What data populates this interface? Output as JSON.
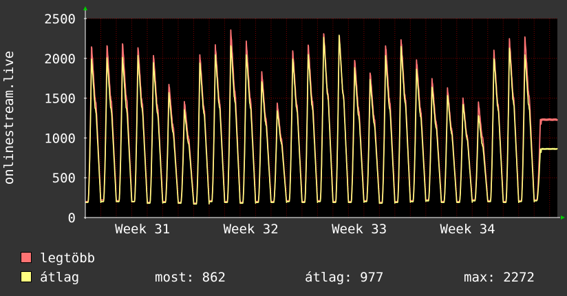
{
  "chart_data": {
    "type": "line",
    "ylabel": "onlinestream.live",
    "ylim": [
      0,
      2500
    ],
    "yticks": [
      0,
      500,
      1000,
      1500,
      2000,
      2500
    ],
    "xticks": [
      "Week 31",
      "Week 32",
      "Week 33",
      "Week 34"
    ],
    "days": 30.5,
    "grid": true,
    "colors": {
      "background": "#333333",
      "plot": "#000000",
      "grid": "#800000",
      "axis": "#ffffff",
      "arrow": "#00cc00"
    },
    "series": [
      {
        "name": "legtöbb",
        "color": "#ff7373",
        "daily_peaks": [
          2150,
          2170,
          2200,
          2150,
          2050,
          1680,
          1460,
          2040,
          2160,
          2340,
          2200,
          1820,
          1430,
          2090,
          2170,
          2320,
          2300,
          1990,
          1830,
          2170,
          2240,
          1980,
          1740,
          1620,
          1490,
          1440,
          2090,
          2240,
          2270,
          1230
        ],
        "daily_mins": [
          200,
          220,
          210,
          200,
          190,
          200,
          190,
          180,
          210,
          200,
          190,
          200,
          200,
          210,
          200,
          210,
          200,
          200,
          210,
          190,
          200,
          210,
          220,
          200,
          200,
          220,
          210,
          200,
          210,
          220
        ]
      },
      {
        "name": "átlag",
        "color": "#ffff80",
        "daily_peaks": [
          1990,
          2000,
          2000,
          2020,
          1930,
          1560,
          1350,
          1940,
          2050,
          2170,
          2060,
          1720,
          1350,
          2000,
          2050,
          2260,
          2280,
          1870,
          1720,
          2020,
          2140,
          1860,
          1640,
          1540,
          1430,
          1290,
          2010,
          2140,
          2050,
          862
        ],
        "daily_mins": [
          190,
          200,
          200,
          200,
          180,
          190,
          180,
          170,
          200,
          190,
          180,
          190,
          190,
          200,
          190,
          200,
          190,
          190,
          200,
          180,
          190,
          200,
          210,
          190,
          190,
          210,
          200,
          190,
          200,
          210
        ]
      }
    ]
  },
  "legend": {
    "max_label": "legtöbb",
    "avg_label": "átlag",
    "now": "most: 862",
    "average": "átlag: 977",
    "max": "max: 2272"
  }
}
